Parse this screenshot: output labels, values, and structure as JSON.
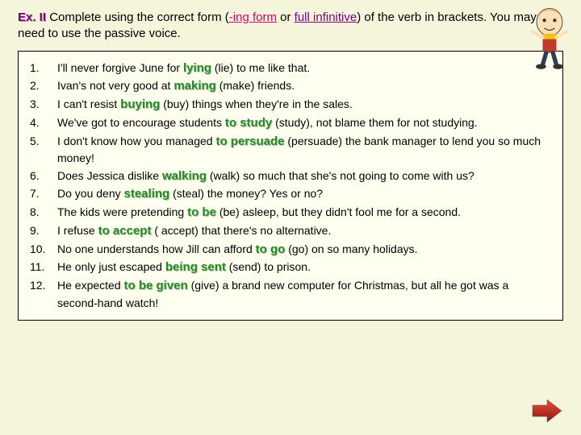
{
  "header": {
    "ex_label": "Ex. II",
    "part1": "  Complete using the correct form (",
    "ing_form": "-ing form",
    "or_text": " or ",
    "full_inf": "full infinitive",
    "part2": ") of the verb in brackets. You may need to use the passive voice."
  },
  "rows": [
    {
      "n": "1.",
      "pre": "I'll never forgive June for   ",
      "ans": "lying",
      "post": "   (lie) to me like that."
    },
    {
      "n": "2.",
      "pre": "Ivan's not very good at   ",
      "ans": "making",
      "post": "         (make) friends."
    },
    {
      "n": "3.",
      "pre": "I can't resist      ",
      "ans": "buying",
      "post": "      (buy) things when they're in the sales."
    },
    {
      "n": "4.",
      "pre": "We've got to encourage students   ",
      "ans": "to study",
      "post": "   (study), not blame them for not studying."
    },
    {
      "n": "5.",
      "pre": "I don't know how you managed  ",
      "ans": "to persuade",
      "post": "       (persuade) the bank manager to lend you so much money!"
    },
    {
      "n": "6.",
      "pre": "Does Jessica dislike    ",
      "ans": "walking",
      "post": "     (walk) so much that she's not going to come with us?"
    },
    {
      "n": "7.",
      "pre": "Do you deny  ",
      "ans": "stealing",
      "post": "      (steal) the money? Yes or no?"
    },
    {
      "n": "8.",
      "pre": "The kids were  pretending  ",
      "ans": "to be",
      "post": "  (be) asleep, but they didn't fool me for a second."
    },
    {
      "n": "9.",
      "pre": "I refuse   ",
      "ans": "to accept",
      "post": " ( accept) that there's no alternative."
    },
    {
      "n": "10.",
      "pre": "No one understands how Jill can afford     ",
      "ans": "to go",
      "post": "     (go) on so many holidays."
    },
    {
      "n": "11.",
      "pre": "He only just escaped     ",
      "ans": "being sent",
      "post": "         (send) to prison."
    },
    {
      "n": "12.",
      "pre": "He expected        ",
      "ans": "to be given",
      "post": "                (give) a brand new computer for Christmas, but all he got was a second-hand watch!"
    }
  ]
}
